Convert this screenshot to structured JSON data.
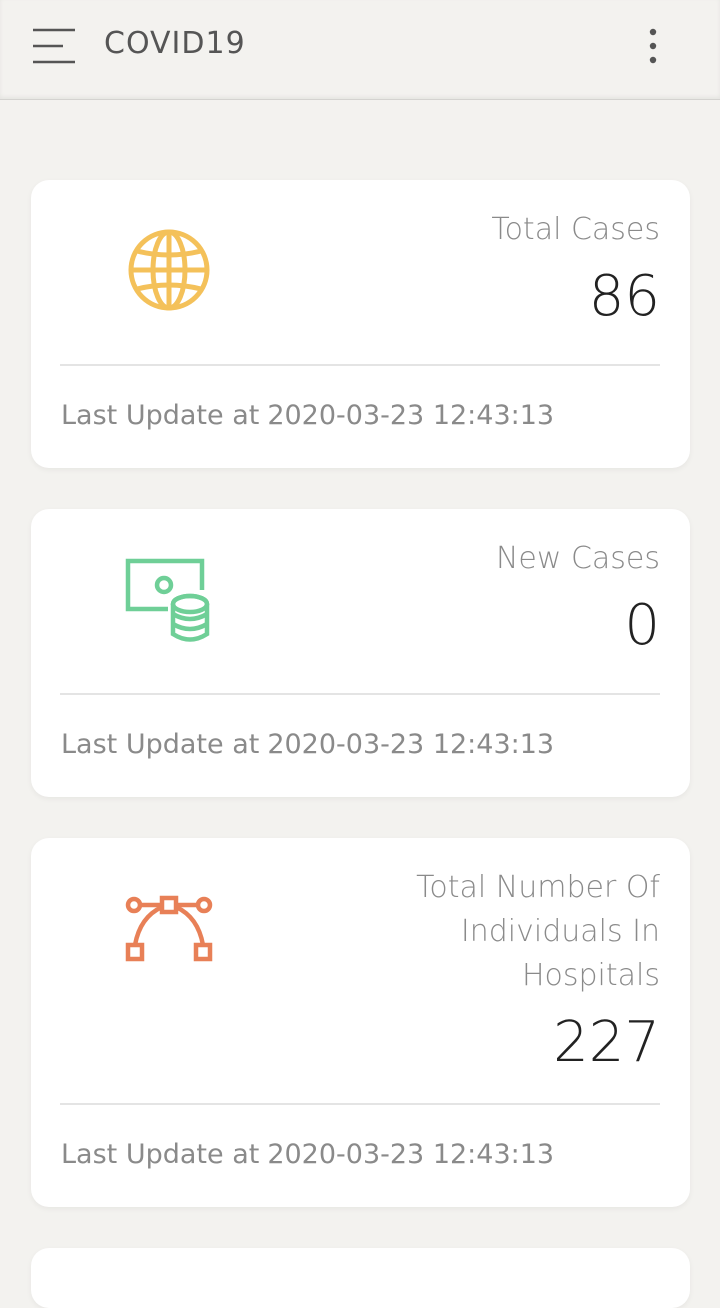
{
  "app": {
    "title": "COVID19",
    "menu_icon": "hamburger-menu-icon",
    "more_icon": "more-vertical-icon"
  },
  "cards": [
    {
      "label": "Total Cases",
      "value": "86",
      "icon": "globe-icon",
      "icon_color": "#f4c15a",
      "update_prefix": "Last Update at",
      "update_time": "2020-03-23 12:43:13"
    },
    {
      "label": "New Cases",
      "value": "0",
      "icon": "money-stack-icon",
      "icon_color": "#6fcf97",
      "update_prefix": "Last Update at",
      "update_time": "2020-03-23 12:43:13"
    },
    {
      "label": "Total Number Of Individuals In Hospitals",
      "value": "227",
      "icon": "bezier-curve-icon",
      "icon_color": "#e88057",
      "update_prefix": "Last Update at",
      "update_time": "2020-03-23 12:43:13"
    }
  ]
}
